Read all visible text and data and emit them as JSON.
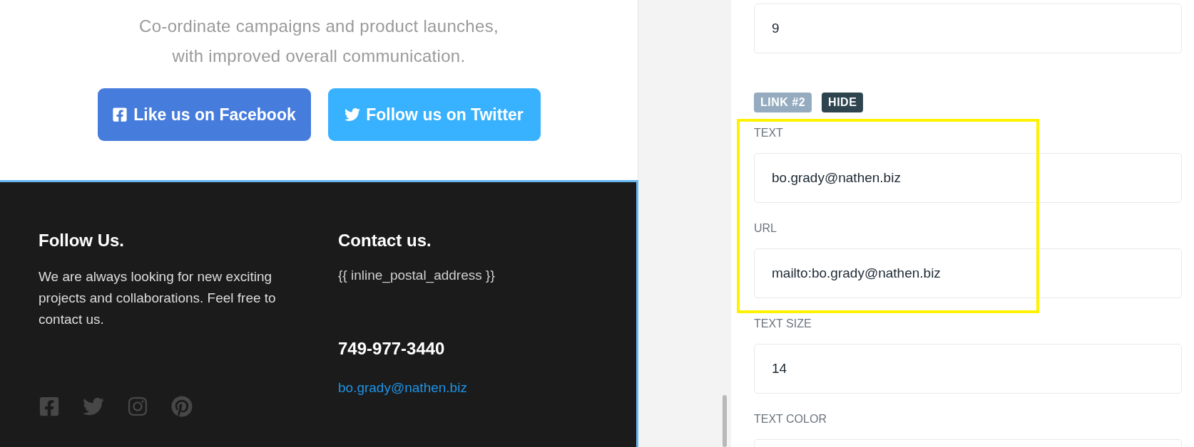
{
  "preview": {
    "tagline_lines": [
      "Co-ordinate campaigns and product launches,",
      "with improved overall communication."
    ],
    "buttons": [
      {
        "label": "Like us on Facebook",
        "kind": "facebook"
      },
      {
        "label": "Follow us on Twitter",
        "kind": "twitter"
      }
    ],
    "footer": {
      "selected": true,
      "follow": {
        "heading": "Follow Us.",
        "text": "We are always looking for new exciting projects and collaborations. Feel free to contact us.",
        "social": [
          {
            "kind": "facebook"
          },
          {
            "kind": "twitter"
          },
          {
            "kind": "instagram"
          },
          {
            "kind": "pinterest"
          }
        ]
      },
      "contact": {
        "heading": "Contact us.",
        "address": "{{ inline_postal_address }}",
        "phone": "749-977-3440",
        "email": "bo.grady@nathen.biz"
      }
    }
  },
  "settings": {
    "top_field": {
      "value": "9"
    },
    "link": {
      "badge": "LINK #2",
      "toggle": "HIDE",
      "highlighted": true,
      "fields": [
        {
          "label": "TEXT",
          "value": "bo.grady@nathen.biz"
        },
        {
          "label": "URL",
          "value": "mailto:bo.grady@nathen.biz"
        },
        {
          "label": "TEXT SIZE",
          "value": "14"
        },
        {
          "label": "TEXT COLOR"
        }
      ]
    }
  }
}
